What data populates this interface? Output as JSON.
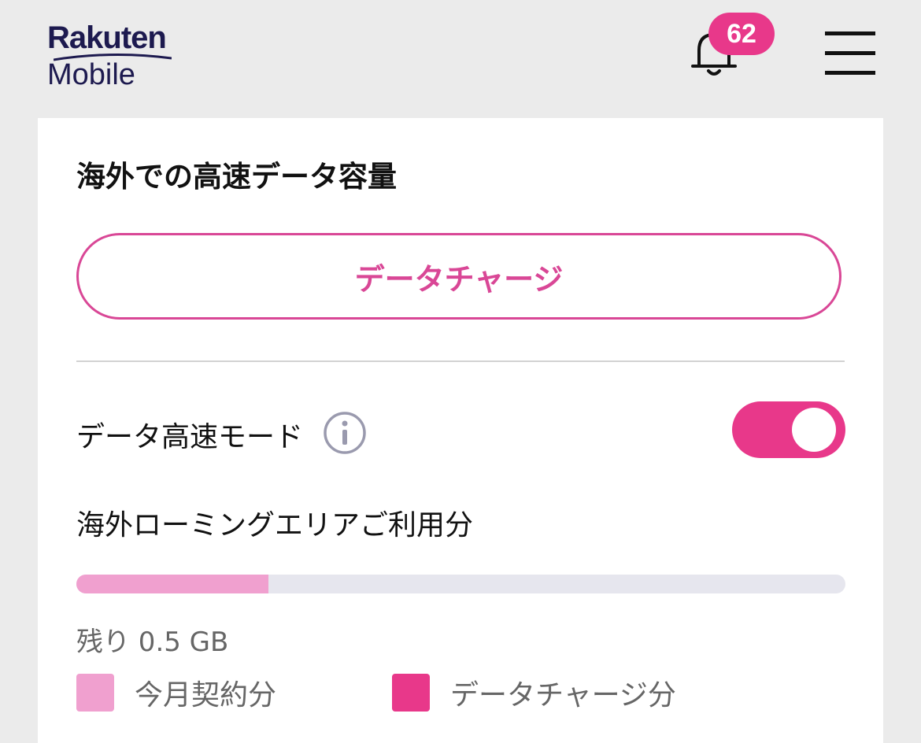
{
  "brand": {
    "name_top": "Rakuten",
    "name_bottom": "Mobile",
    "color": "#1d1a4f"
  },
  "header": {
    "notification_count": "62",
    "notification_icon": "bell-icon",
    "menu_icon": "hamburger-menu-icon",
    "accent": "#e8388a"
  },
  "card": {
    "title": "海外での高速データ容量",
    "charge_button_label": "データチャージ",
    "high_speed_mode": {
      "label": "データ高速モード",
      "info_icon": "info-icon",
      "enabled": true
    },
    "usage": {
      "section_label": "海外ローミングエリアご利用分",
      "fill_fraction": 0.25,
      "remaining_text": "残り 0.5 GB"
    },
    "legend": [
      {
        "label": "今月契約分",
        "color": "#f0a0cf"
      },
      {
        "label": "データチャージ分",
        "color": "#e8388a"
      }
    ]
  }
}
